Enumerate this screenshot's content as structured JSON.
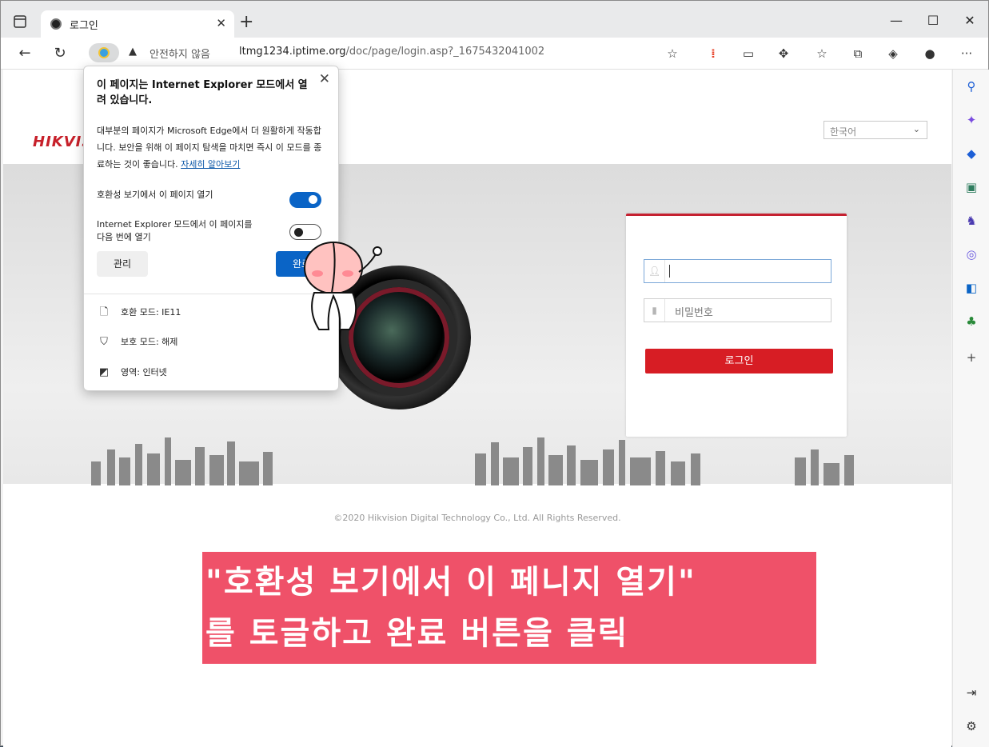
{
  "browser": {
    "tab_title": "로그인",
    "security_text": "안전하지 않음",
    "url_host": "ltmg1234.iptime.org",
    "url_path": "/doc/page/login.asp?_1675432041002"
  },
  "page": {
    "logo": "HIKVIS",
    "language": "한국어",
    "login": {
      "password_placeholder": "비밀번호",
      "login_button": "로그인"
    },
    "copyright": "©2020 Hikvision Digital Technology Co., Ltd. All Rights Reserved."
  },
  "popup": {
    "title": "이 페이지는 Internet Explorer 모드에서 열려 있습니다.",
    "description": "대부분의 페이지가 Microsoft Edge에서 더 원활하게 작동합니다. 보안을 위해 이 페이지 탐색을 마치면 즉시 이 모드를 종료하는 것이 좋습니다.",
    "learn_more": "자세히 알아보기",
    "toggle1_label": "호환성 보기에서 이 페이지 열기",
    "toggle1_on": true,
    "toggle2_label": "Internet Explorer 모드에서 이 페이지를 다음 번에 열기",
    "toggle2_on": false,
    "manage_button": "관리",
    "done_button": "완료",
    "info": [
      {
        "icon": "document-icon",
        "text": "호환 모드: IE11"
      },
      {
        "icon": "shield-icon",
        "text": "보호 모드: 해제"
      },
      {
        "icon": "zone-icon",
        "text": "영역: 인터넷"
      }
    ]
  },
  "annotation": {
    "line1": "\"호환성 보기에서 이 페니지 열기\"",
    "line2": "를 토글하고 완료 버튼을 클릭"
  },
  "colors": {
    "accent": "#0a64c6",
    "hik_red": "#d71d24",
    "caption_bg": "#ef5169"
  }
}
